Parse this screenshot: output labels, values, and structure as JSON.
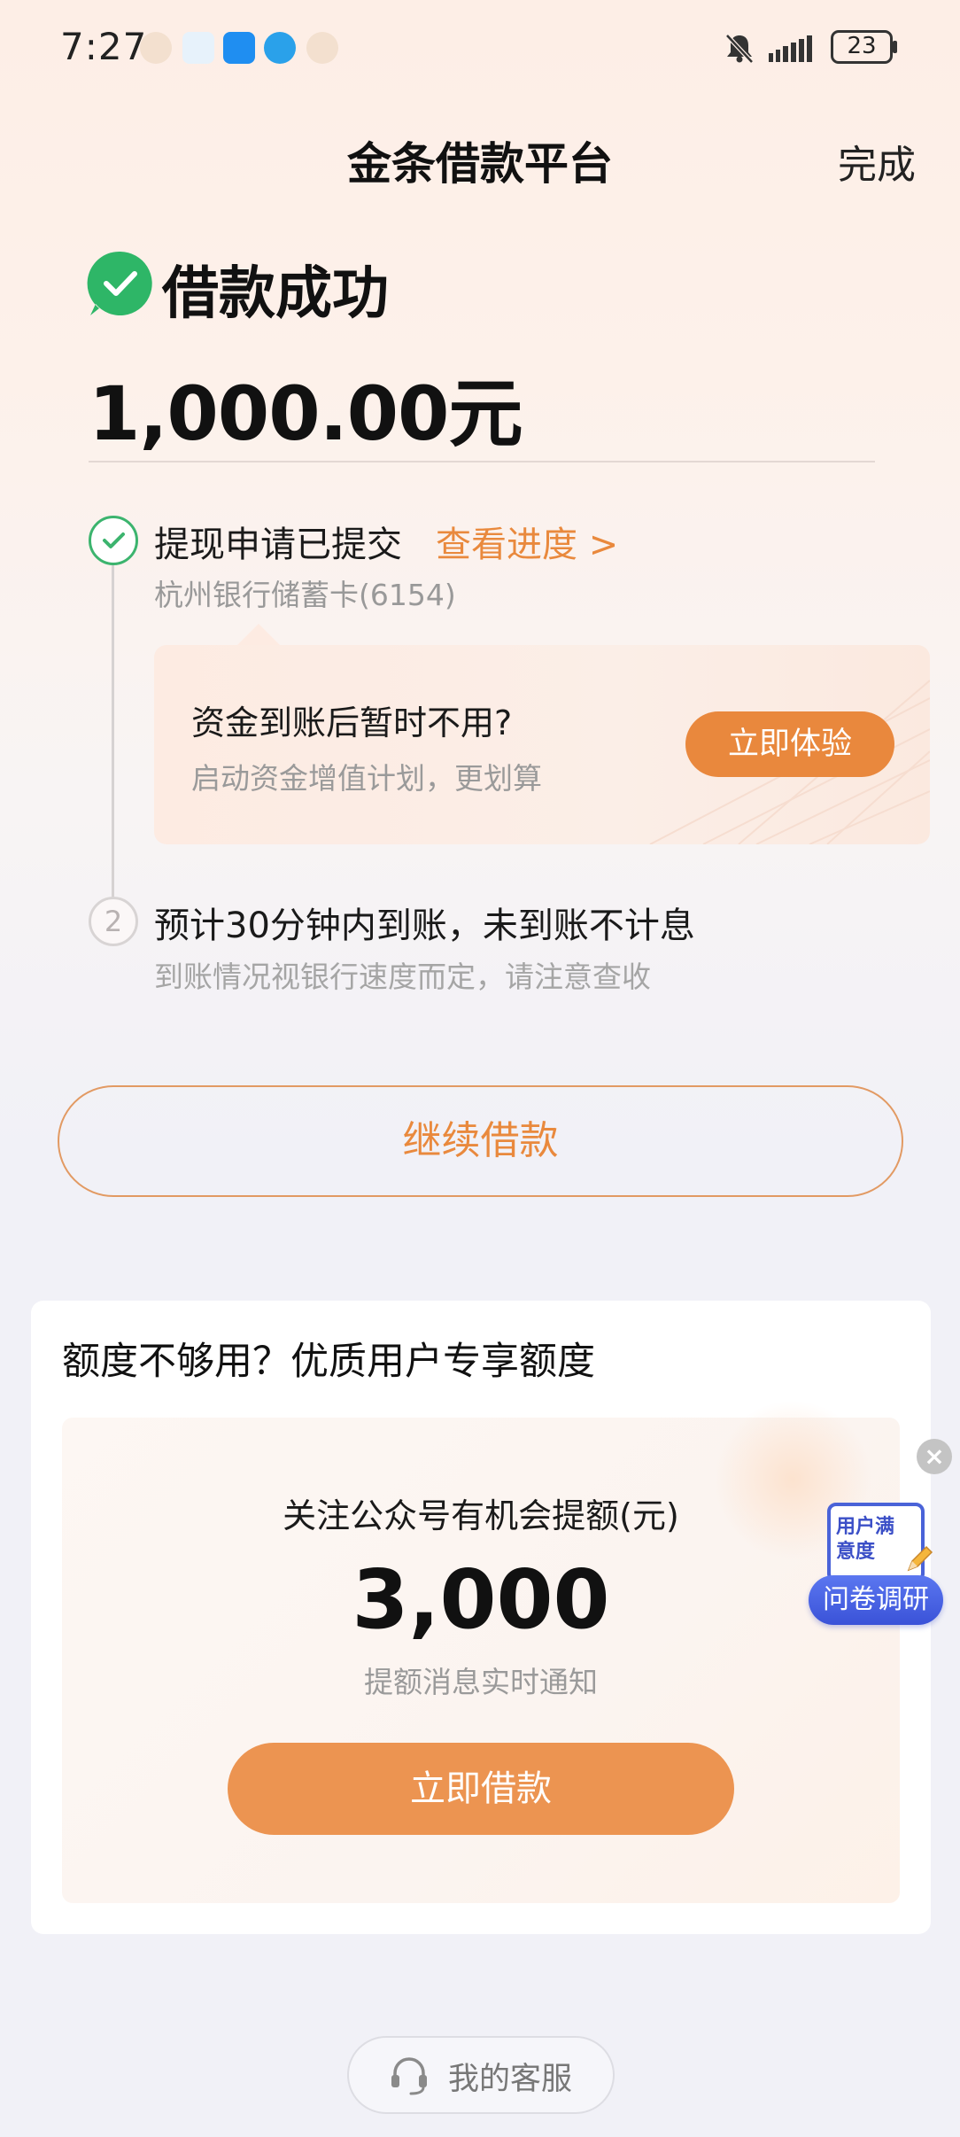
{
  "status_bar": {
    "time": "7:27",
    "battery": "23"
  },
  "nav": {
    "title": "金条借款平台",
    "done_label": "完成"
  },
  "result": {
    "title": "借款成功",
    "amount": "1,000.00元"
  },
  "timeline": {
    "step1": {
      "title": "提现申请已提交",
      "link": "查看进度 >",
      "sub": "杭州银行储蓄卡(6154)"
    },
    "promo": {
      "title": "资金到账后暂时不用?",
      "sub": "启动资金增值计划，更划算",
      "button": "立即体验"
    },
    "step2": {
      "number": "2",
      "title": "预计30分钟内到账，未到账不计息",
      "sub": "到账情况视银行速度而定，请注意查收"
    }
  },
  "continue_button": "继续借款",
  "quota": {
    "title": "额度不够用？优质用户专享额度",
    "label": "关注公众号有机会提额(元)",
    "value": "3,000",
    "note": "提额消息实时通知",
    "button": "立即借款"
  },
  "survey": {
    "close": "×",
    "card_text": "用户满意度",
    "button": "问卷调研"
  },
  "service": {
    "label": "我的客服"
  },
  "colors": {
    "accent": "#e9893d",
    "success": "#3cb46e",
    "survey_blue": "#4a63d8"
  }
}
